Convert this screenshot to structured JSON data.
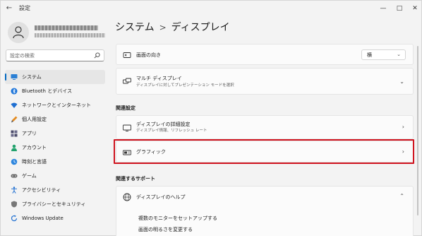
{
  "window": {
    "title": "設定"
  },
  "sidebar": {
    "search_placeholder": "設定の検索",
    "items": [
      {
        "label": "システム",
        "icon": "monitor-icon",
        "active": true
      },
      {
        "label": "Bluetooth とデバイス",
        "icon": "bluetooth-icon"
      },
      {
        "label": "ネットワークとインターネット",
        "icon": "wifi-icon"
      },
      {
        "label": "個人用設定",
        "icon": "brush-icon"
      },
      {
        "label": "アプリ",
        "icon": "apps-icon"
      },
      {
        "label": "アカウント",
        "icon": "person-icon"
      },
      {
        "label": "時刻と言語",
        "icon": "clock-globe-icon"
      },
      {
        "label": "ゲーム",
        "icon": "gamepad-icon"
      },
      {
        "label": "アクセシビリティ",
        "icon": "accessibility-icon"
      },
      {
        "label": "プライバシーとセキュリティ",
        "icon": "shield-icon"
      },
      {
        "label": "Windows Update",
        "icon": "update-icon"
      }
    ]
  },
  "main": {
    "breadcrumb": {
      "parent": "システム",
      "separator": ">",
      "current": "ディスプレイ"
    },
    "orientation": {
      "title": "画面の向き",
      "value": "横"
    },
    "multi_display": {
      "title": "マルチ ディスプレイ",
      "subtitle": "ディスプレイに対してプレゼンテーション モードを選択"
    },
    "related_settings": {
      "heading": "関連設定",
      "advanced_display": {
        "title": "ディスプレイの詳細設定",
        "subtitle": "ディスプレイ情報、リフレッシュ レート"
      },
      "graphics": {
        "title": "グラフィック"
      }
    },
    "related_support": {
      "heading": "関連するサポート",
      "display_help": {
        "title": "ディスプレイのヘルプ"
      },
      "links": [
        "複数のモニターをセットアップする",
        "画面の明るさを変更する"
      ]
    }
  },
  "colors": {
    "accent": "#0067c0",
    "highlight_border": "#d0141f"
  }
}
